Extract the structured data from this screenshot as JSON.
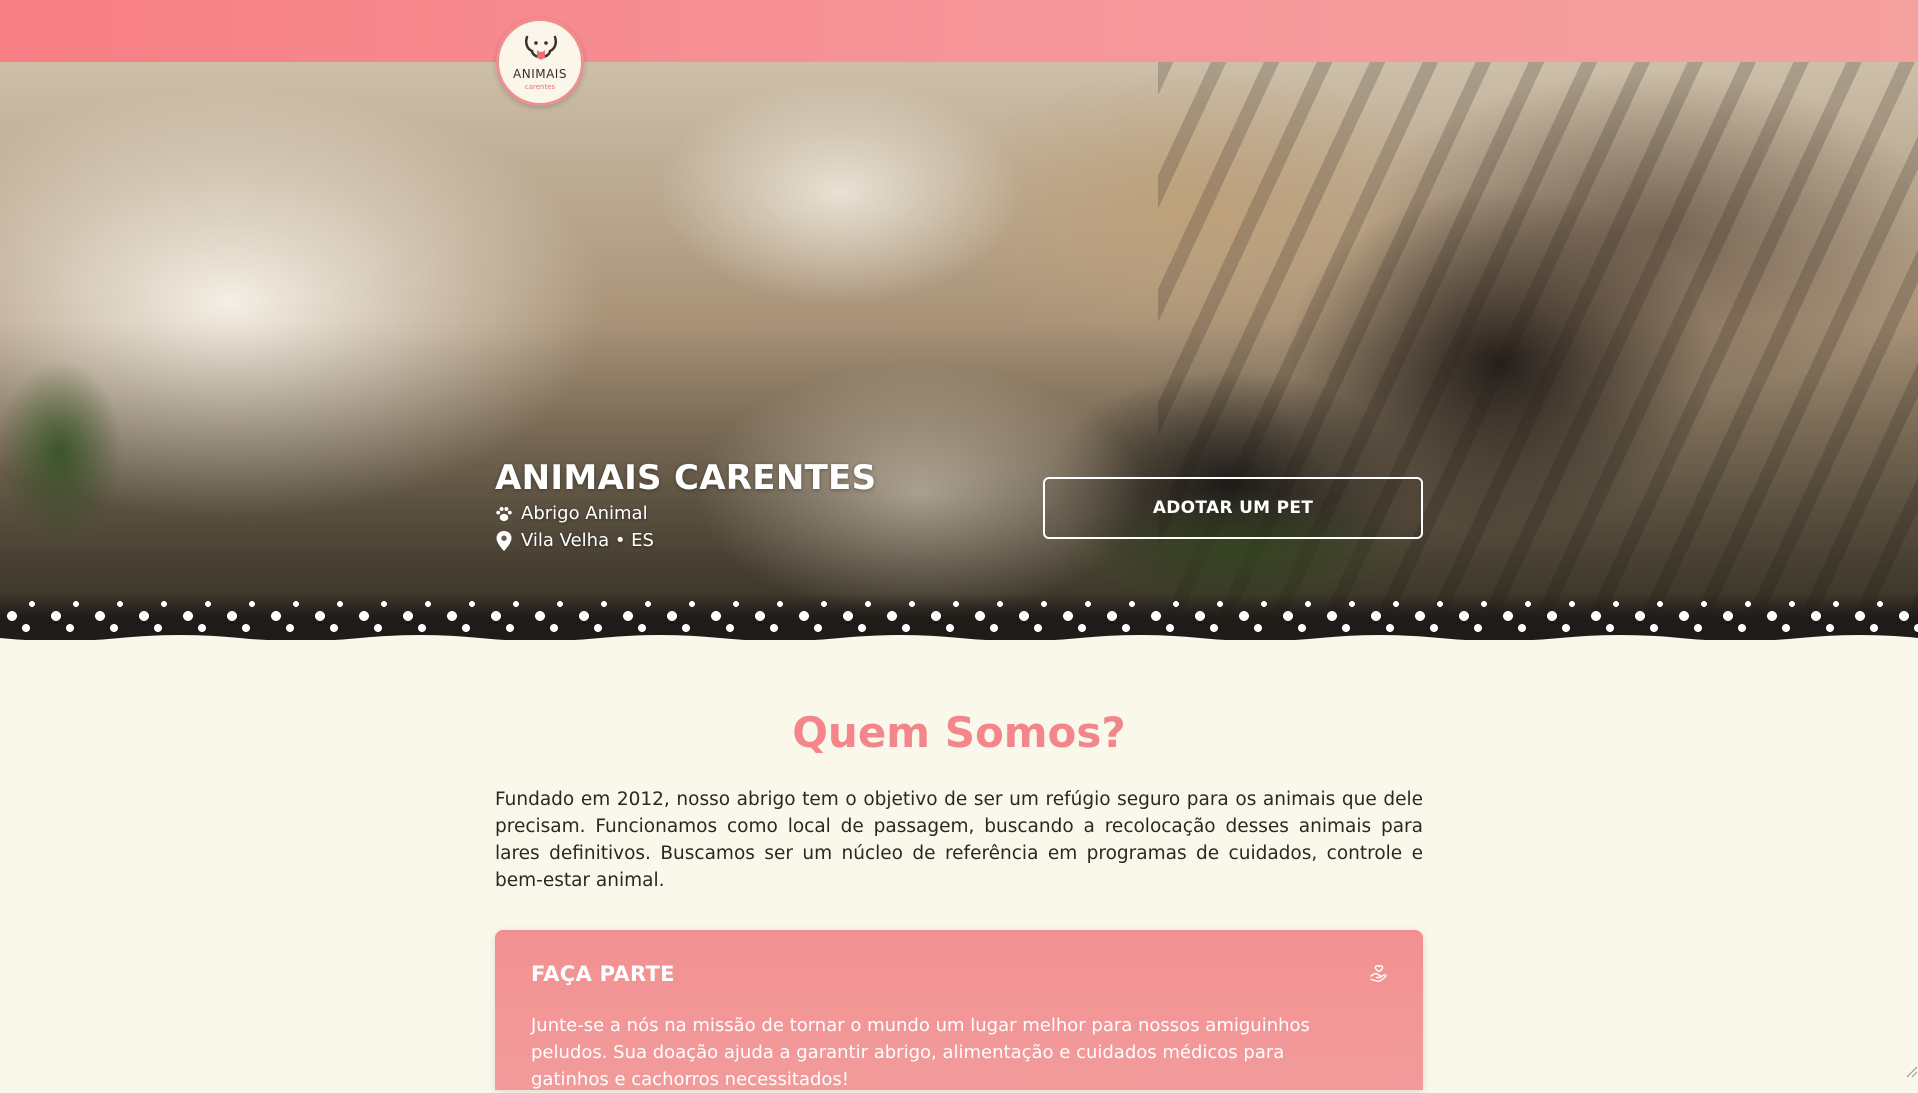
{
  "header": {
    "logo_word": "ANIMAIS",
    "logo_sub": "carentes",
    "logo_icon": "dog-face-logo-icon"
  },
  "hero": {
    "title": "ANIMAIS CARENTES",
    "type_label": "Abrigo Animal",
    "type_icon": "paw-icon",
    "location_label": "Vila Velha • ES",
    "location_icon": "map-pin-icon",
    "adopt_button": "ADOTAR UM PET"
  },
  "about": {
    "title": "Quem Somos?",
    "text": "Fundado em 2012, nosso abrigo tem o objetivo de ser um refúgio seguro para os animais que dele precisam. Funcionamos como local de passagem, buscando a recolocação desses animais para lares definitivos. Buscamos ser um núcleo de referência em programas de cuidados, controle e bem-estar animal."
  },
  "card": {
    "title": "FAÇA PARTE",
    "icon": "hand-heart-icon",
    "text": "Junte-se a nós na missão de tornar o mundo um lugar melhor para nossos amiguinhos peludos. Sua doação ajuda a garantir abrigo, alimentação e cuidados médicos para gatinhos e cachorros necessitados!"
  },
  "colors": {
    "primary": "#f2868a",
    "background": "#faf8ea",
    "text": "#2d2623"
  }
}
